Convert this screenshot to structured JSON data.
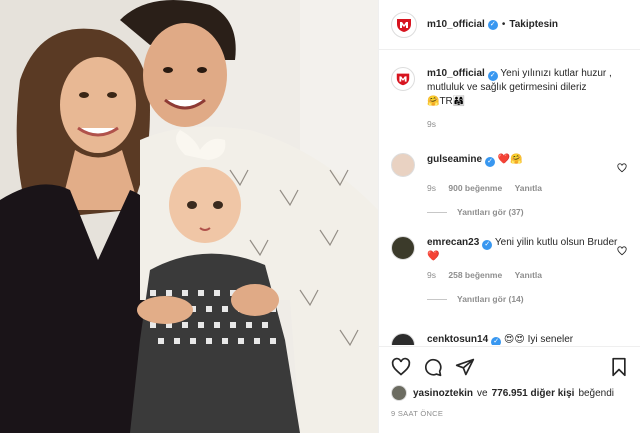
{
  "header": {
    "username": "m10_official",
    "separator": "•",
    "follow_label": "Takiptesin"
  },
  "caption": {
    "username": "m10_official",
    "text": "Yeni yılınızı kutlar huzur , mutluluk ve sağlık getirmesini dileriz",
    "emoji": "🤗TR👨‍👩‍👧",
    "time": "9s"
  },
  "comments": [
    {
      "username": "gulseamine",
      "text": "",
      "emoji": "❤️🤗",
      "time": "9s",
      "likes": "900 beğenme",
      "reply": "Yanıtla",
      "view_replies": "Yanıtları gör (37)"
    },
    {
      "username": "emrecan23",
      "text": "Yeni yilin kutlu olsun Bruder",
      "emoji": "❤️",
      "time": "9s",
      "likes": "258 beğenme",
      "reply": "Yanıtla",
      "view_replies": "Yanıtları gör (14)"
    },
    {
      "username": "cenktosun14",
      "text": "Iyi seneler",
      "emoji": "😍😍"
    }
  ],
  "likes": {
    "user": "yasinoztekin",
    "connector": "ve",
    "others": "776.951 diğer kişi",
    "suffix": "beğendi"
  },
  "timestamp": "9 SAAT ÖNCE",
  "icons": {
    "like": "heart-icon",
    "comment": "comment-icon",
    "share": "share-icon",
    "save": "bookmark-icon",
    "verified": "verified-badge-icon"
  },
  "colors": {
    "verified": "#3897f0",
    "heart": "#ed4956",
    "muted": "#8e8e8e",
    "text": "#262626"
  }
}
